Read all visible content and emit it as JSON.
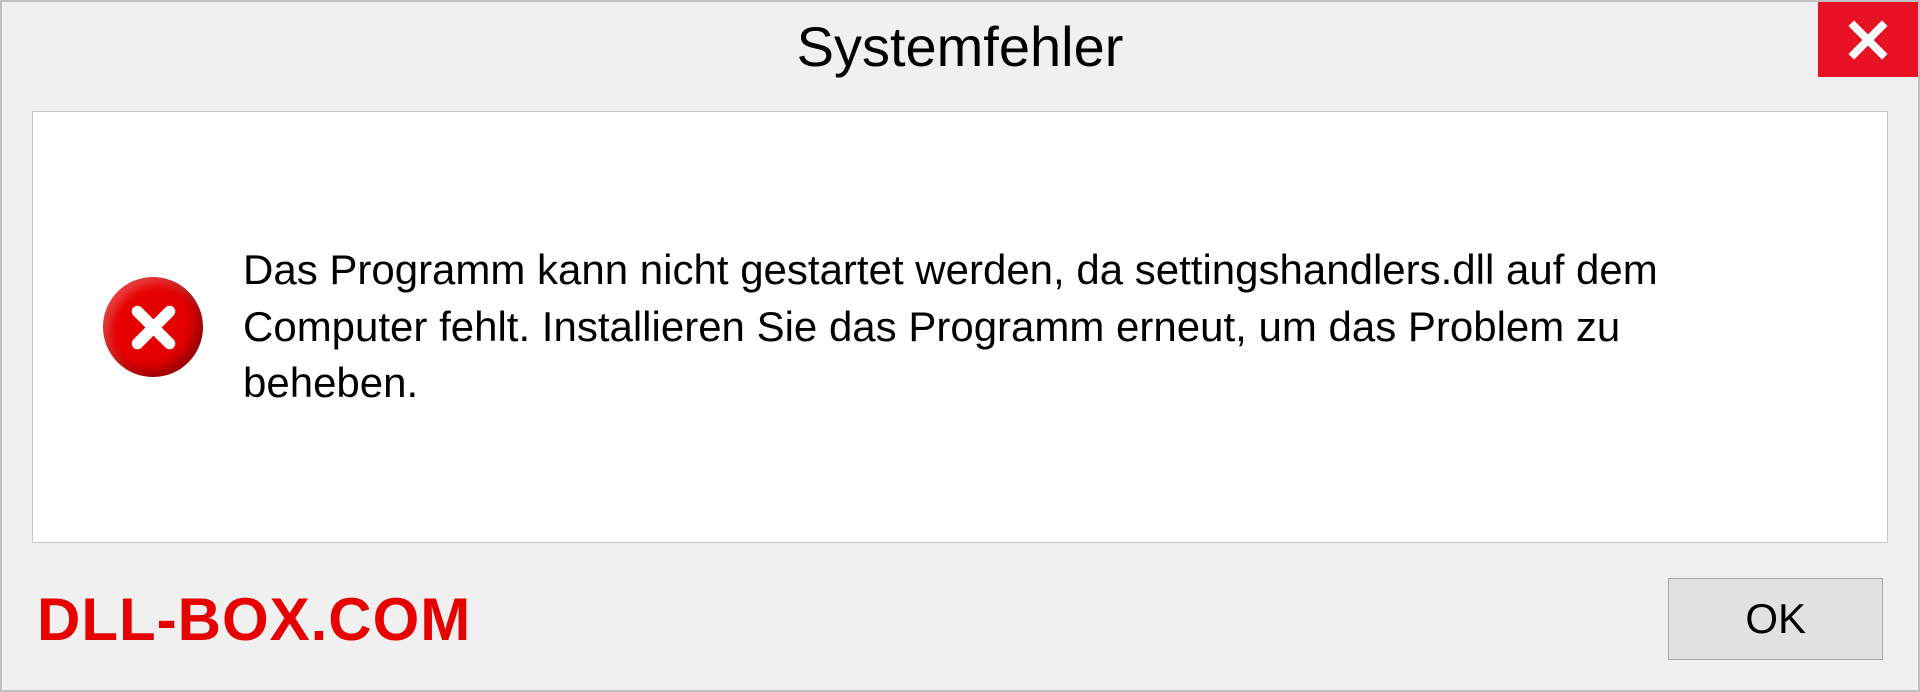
{
  "dialog": {
    "title": "Systemfehler",
    "message": "Das Programm kann nicht gestartet werden, da settingshandlers.dll auf dem Computer fehlt. Installieren Sie das Programm erneut, um das Problem zu beheben.",
    "ok_label": "OK"
  },
  "watermark": "DLL-BOX.COM"
}
